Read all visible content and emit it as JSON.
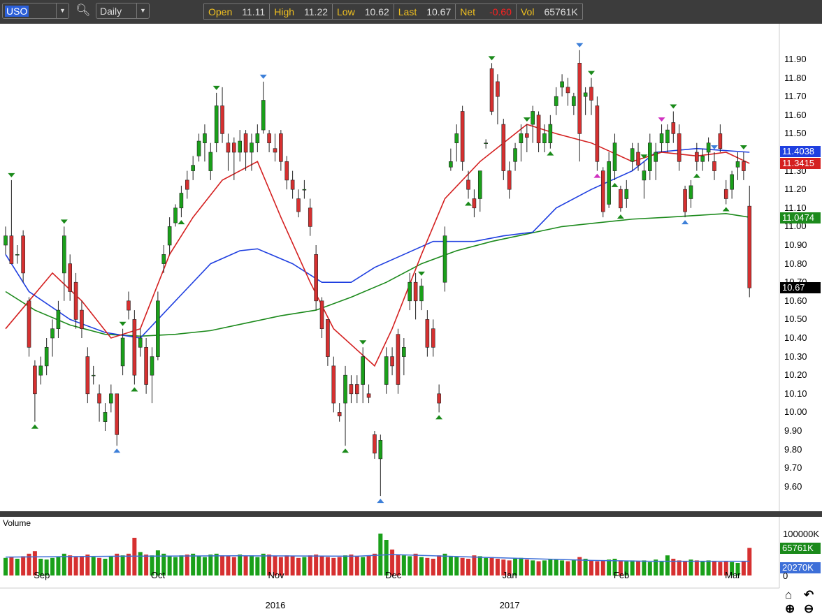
{
  "toolbar": {
    "symbol": "USO",
    "interval": "Daily",
    "open_label": "Open",
    "open": "11.11",
    "high_label": "High",
    "high": "11.22",
    "low_label": "Low",
    "low": "10.62",
    "last_label": "Last",
    "last": "10.67",
    "net_label": "Net",
    "net": "-0.60",
    "vol_label": "Vol",
    "vol": "65761K",
    "icons": {
      "search": "search-icon",
      "dropdown": "chevron-down-icon"
    }
  },
  "colors": {
    "up": "#1aa01a",
    "down": "#d63030",
    "ma_short": "#d42020",
    "ma_mid": "#1f3fe0",
    "ma_long": "#1c8a1c",
    "net": "#ff2020",
    "label": "#f0c020"
  },
  "price_tags": {
    "ma_mid": "11.4038",
    "ma_short": "11.3415",
    "ma_long": "11.0474",
    "last": "10.67"
  },
  "volume": {
    "title": "Volume",
    "max_label": "100000K",
    "last_label": "65761K",
    "avg_label": "20270K",
    "zero_label": "0"
  },
  "x_labels": {
    "months": [
      "Sep",
      "Oct",
      "Nov",
      "Dec",
      "Jan",
      "Feb",
      "Mar"
    ],
    "years": [
      "2016",
      "2017"
    ]
  },
  "nav_icons": [
    "home-icon",
    "undo-icon",
    "zoom-in-icon",
    "zoom-out-icon"
  ],
  "chart_data": {
    "type": "candlestick",
    "ylim": [
      9.52,
      12.08
    ],
    "y_ticks": [
      "11.90",
      "11.80",
      "11.70",
      "11.60",
      "11.50",
      "11.40",
      "11.30",
      "11.20",
      "11.10",
      "11.00",
      "10.90",
      "10.80",
      "10.70",
      "10.60",
      "10.50",
      "10.40",
      "10.30",
      "10.20",
      "10.10",
      "10.00",
      "9.90",
      "9.80",
      "9.70",
      "9.60"
    ],
    "month_start_index": [
      6,
      26,
      46,
      66,
      86,
      105,
      124
    ],
    "ohlc": [
      [
        10.9,
        11.0,
        10.85,
        10.95
      ],
      [
        10.95,
        11.25,
        10.8,
        10.8
      ],
      [
        10.85,
        10.9,
        10.8,
        10.85
      ],
      [
        10.95,
        10.98,
        10.7,
        10.75
      ],
      [
        10.6,
        10.62,
        10.3,
        10.35
      ],
      [
        10.25,
        10.28,
        9.95,
        10.1
      ],
      [
        10.2,
        10.3,
        10.15,
        10.25
      ],
      [
        10.25,
        10.4,
        10.2,
        10.35
      ],
      [
        10.4,
        10.5,
        10.3,
        10.45
      ],
      [
        10.45,
        10.6,
        10.4,
        10.55
      ],
      [
        10.75,
        11.0,
        10.6,
        10.95
      ],
      [
        10.8,
        10.85,
        10.6,
        10.65
      ],
      [
        10.7,
        10.75,
        10.45,
        10.5
      ],
      [
        10.55,
        10.6,
        10.4,
        10.45
      ],
      [
        10.3,
        10.35,
        10.05,
        10.1
      ],
      [
        10.2,
        10.25,
        10.15,
        10.2
      ],
      [
        10.1,
        10.15,
        9.95,
        10.05
      ],
      [
        9.95,
        10.05,
        9.9,
        10.0
      ],
      [
        10.05,
        10.15,
        10.0,
        10.1
      ],
      [
        10.1,
        10.1,
        9.82,
        9.88
      ],
      [
        10.25,
        10.45,
        10.2,
        10.4
      ],
      [
        10.6,
        10.65,
        10.5,
        10.55
      ],
      [
        10.5,
        10.55,
        10.15,
        10.2
      ],
      [
        10.35,
        10.45,
        10.3,
        10.4
      ],
      [
        10.35,
        10.4,
        10.1,
        10.15
      ],
      [
        10.2,
        10.35,
        10.05,
        10.3
      ],
      [
        10.3,
        10.65,
        10.28,
        10.6
      ],
      [
        10.8,
        10.9,
        10.75,
        10.85
      ],
      [
        10.9,
        11.05,
        10.85,
        11.0
      ],
      [
        11.02,
        11.12,
        11.0,
        11.1
      ],
      [
        11.1,
        11.22,
        11.05,
        11.18
      ],
      [
        11.25,
        11.3,
        11.15,
        11.2
      ],
      [
        11.3,
        11.38,
        11.25,
        11.33
      ],
      [
        11.38,
        11.5,
        11.35,
        11.46
      ],
      [
        11.45,
        11.55,
        11.35,
        11.5
      ],
      [
        11.3,
        11.45,
        11.25,
        11.4
      ],
      [
        11.45,
        11.72,
        11.4,
        11.65
      ],
      [
        11.65,
        11.75,
        11.45,
        11.5
      ],
      [
        11.45,
        11.5,
        11.3,
        11.4
      ],
      [
        11.45,
        11.48,
        11.25,
        11.4
      ],
      [
        11.4,
        11.52,
        11.35,
        11.46
      ],
      [
        11.5,
        11.52,
        11.3,
        11.4
      ],
      [
        11.4,
        11.5,
        11.3,
        11.45
      ],
      [
        11.45,
        11.55,
        11.4,
        11.5
      ],
      [
        11.52,
        11.78,
        11.5,
        11.68
      ],
      [
        11.5,
        11.52,
        11.4,
        11.45
      ],
      [
        11.42,
        11.5,
        11.35,
        11.4
      ],
      [
        11.5,
        11.52,
        11.3,
        11.35
      ],
      [
        11.35,
        11.38,
        11.2,
        11.25
      ],
      [
        11.25,
        11.3,
        11.15,
        11.2
      ],
      [
        11.15,
        11.2,
        11.05,
        11.08
      ],
      [
        11.2,
        11.25,
        11.15,
        11.2
      ],
      [
        11.1,
        11.15,
        10.95,
        11.0
      ],
      [
        10.85,
        10.9,
        10.55,
        10.6
      ],
      [
        10.6,
        10.62,
        10.4,
        10.45
      ],
      [
        10.5,
        10.5,
        10.25,
        10.3
      ],
      [
        10.25,
        10.3,
        10.0,
        10.05
      ],
      [
        10.0,
        10.05,
        9.95,
        9.98
      ],
      [
        10.05,
        10.25,
        9.82,
        10.2
      ],
      [
        10.15,
        10.2,
        10.05,
        10.1
      ],
      [
        10.15,
        10.2,
        10.05,
        10.1
      ],
      [
        10.15,
        10.35,
        10.05,
        10.3
      ],
      [
        10.1,
        10.15,
        10.05,
        10.08
      ],
      [
        9.88,
        9.9,
        9.75,
        9.78
      ],
      [
        9.75,
        9.88,
        9.55,
        9.85
      ],
      [
        10.15,
        10.35,
        10.1,
        10.3
      ],
      [
        10.3,
        10.35,
        10.2,
        10.25
      ],
      [
        10.42,
        10.45,
        10.1,
        10.15
      ],
      [
        10.3,
        10.4,
        10.2,
        10.35
      ],
      [
        10.6,
        10.75,
        10.55,
        10.7
      ],
      [
        10.7,
        10.75,
        10.5,
        10.6
      ],
      [
        10.6,
        10.72,
        10.55,
        10.68
      ],
      [
        10.5,
        10.55,
        10.3,
        10.35
      ],
      [
        10.45,
        10.5,
        10.3,
        10.35
      ],
      [
        10.1,
        10.15,
        10.0,
        10.05
      ],
      [
        10.7,
        11.0,
        10.65,
        10.95
      ],
      [
        11.32,
        11.42,
        11.3,
        11.35
      ],
      [
        11.45,
        11.55,
        11.35,
        11.5
      ],
      [
        11.62,
        11.65,
        11.3,
        11.35
      ],
      [
        11.25,
        11.3,
        11.15,
        11.2
      ],
      [
        11.15,
        11.2,
        11.05,
        11.1
      ],
      [
        11.15,
        11.3,
        11.08,
        11.3
      ],
      [
        11.45,
        11.47,
        11.42,
        11.45
      ],
      [
        11.85,
        11.88,
        11.6,
        11.62
      ],
      [
        11.78,
        11.82,
        11.55,
        11.7
      ],
      [
        11.55,
        11.58,
        11.25,
        11.3
      ],
      [
        11.3,
        11.35,
        11.15,
        11.2
      ],
      [
        11.35,
        11.45,
        11.3,
        11.42
      ],
      [
        11.45,
        11.55,
        11.35,
        11.5
      ],
      [
        11.5,
        11.55,
        11.4,
        11.48
      ],
      [
        11.55,
        11.65,
        11.45,
        11.62
      ],
      [
        11.6,
        11.62,
        11.4,
        11.45
      ],
      [
        11.45,
        11.55,
        11.4,
        11.5
      ],
      [
        11.45,
        11.6,
        11.42,
        11.55
      ],
      [
        11.65,
        11.75,
        11.6,
        11.7
      ],
      [
        11.75,
        11.82,
        11.7,
        11.78
      ],
      [
        11.75,
        11.8,
        11.65,
        11.72
      ],
      [
        11.65,
        11.72,
        11.6,
        11.7
      ],
      [
        11.88,
        11.95,
        11.35,
        11.5
      ],
      [
        11.7,
        11.75,
        11.6,
        11.72
      ],
      [
        11.75,
        11.8,
        11.6,
        11.68
      ],
      [
        11.65,
        11.7,
        11.3,
        11.35
      ],
      [
        11.3,
        11.32,
        11.05,
        11.08
      ],
      [
        11.12,
        11.4,
        11.1,
        11.35
      ],
      [
        11.3,
        11.5,
        11.25,
        11.45
      ],
      [
        11.2,
        11.22,
        11.08,
        11.1
      ],
      [
        11.15,
        11.25,
        11.1,
        11.2
      ],
      [
        11.35,
        11.45,
        11.3,
        11.42
      ],
      [
        11.4,
        11.45,
        11.3,
        11.33
      ],
      [
        11.25,
        11.35,
        11.15,
        11.3
      ],
      [
        11.3,
        11.5,
        11.25,
        11.45
      ],
      [
        11.35,
        11.45,
        11.25,
        11.4
      ],
      [
        11.45,
        11.55,
        11.4,
        11.5
      ],
      [
        11.45,
        11.55,
        11.4,
        11.52
      ],
      [
        11.56,
        11.62,
        11.45,
        11.5
      ],
      [
        11.5,
        11.55,
        11.3,
        11.35
      ],
      [
        11.2,
        11.22,
        11.05,
        11.08
      ],
      [
        11.15,
        11.25,
        11.1,
        11.22
      ],
      [
        11.4,
        11.45,
        11.3,
        11.35
      ],
      [
        11.35,
        11.42,
        11.3,
        11.38
      ],
      [
        11.4,
        11.48,
        11.35,
        11.45
      ],
      [
        11.35,
        11.4,
        11.25,
        11.3
      ],
      [
        11.5,
        11.55,
        11.4,
        11.42
      ],
      [
        11.2,
        11.25,
        11.12,
        11.15
      ],
      [
        11.2,
        11.3,
        11.15,
        11.28
      ],
      [
        11.32,
        11.4,
        11.25,
        11.35
      ],
      [
        11.35,
        11.4,
        11.25,
        11.3
      ],
      [
        11.11,
        11.22,
        10.62,
        10.67
      ]
    ],
    "volume_k": [
      42000,
      44000,
      40000,
      46000,
      52000,
      58000,
      40000,
      38000,
      42000,
      45000,
      52000,
      48000,
      44000,
      46000,
      50000,
      44000,
      42000,
      40000,
      45000,
      52000,
      48000,
      52000,
      90000,
      56000,
      50000,
      48000,
      60000,
      52000,
      46000,
      44000,
      48000,
      50000,
      52000,
      46000,
      44000,
      50000,
      52000,
      48000,
      46000,
      44000,
      50000,
      46000,
      48000,
      44000,
      52000,
      50000,
      46000,
      44000,
      48000,
      46000,
      42000,
      44000,
      48000,
      50000,
      46000,
      44000,
      42000,
      44000,
      48000,
      50000,
      46000,
      44000,
      48000,
      52000,
      100000,
      85000,
      62000,
      50000,
      48000,
      46000,
      52000,
      44000,
      42000,
      40000,
      48000,
      52000,
      46000,
      44000,
      42000,
      40000,
      48000,
      46000,
      42000,
      44000,
      40000,
      38000,
      36000,
      40000,
      42000,
      38000,
      36000,
      34000,
      36000,
      40000,
      38000,
      36000,
      34000,
      38000,
      44000,
      40000,
      36000,
      34000,
      36000,
      38000,
      40000,
      36000,
      34000,
      36000,
      34000,
      36000,
      32000,
      38000,
      34000,
      48000,
      40000,
      36000,
      34000,
      38000,
      36000,
      34000,
      36000,
      34000,
      32000,
      34000,
      32000,
      30000,
      34000,
      65761
    ],
    "volume_avg_k": 20270,
    "ma_short": [
      [
        0,
        10.45
      ],
      [
        4,
        10.6
      ],
      [
        8,
        10.75
      ],
      [
        13,
        10.6
      ],
      [
        18,
        10.4
      ],
      [
        23,
        10.45
      ],
      [
        28,
        10.85
      ],
      [
        32,
        11.05
      ],
      [
        37,
        11.25
      ],
      [
        43,
        11.35
      ],
      [
        47,
        11.05
      ],
      [
        52,
        10.7
      ],
      [
        56,
        10.45
      ],
      [
        63,
        10.25
      ],
      [
        66,
        10.45
      ],
      [
        71,
        10.85
      ],
      [
        75,
        11.15
      ],
      [
        81,
        11.35
      ],
      [
        85,
        11.45
      ],
      [
        89,
        11.55
      ],
      [
        94,
        11.5
      ],
      [
        100,
        11.45
      ],
      [
        107,
        11.35
      ],
      [
        112,
        11.4
      ],
      [
        118,
        11.38
      ],
      [
        123,
        11.4
      ],
      [
        127,
        11.34
      ]
    ],
    "ma_mid": [
      [
        0,
        10.85
      ],
      [
        4,
        10.65
      ],
      [
        11,
        10.5
      ],
      [
        17,
        10.43
      ],
      [
        23,
        10.4
      ],
      [
        29,
        10.6
      ],
      [
        35,
        10.8
      ],
      [
        40,
        10.87
      ],
      [
        43,
        10.88
      ],
      [
        49,
        10.8
      ],
      [
        54,
        10.7
      ],
      [
        59,
        10.7
      ],
      [
        63,
        10.78
      ],
      [
        68,
        10.85
      ],
      [
        73,
        10.92
      ],
      [
        80,
        10.92
      ],
      [
        85,
        10.95
      ],
      [
        90,
        10.97
      ],
      [
        94,
        11.1
      ],
      [
        100,
        11.2
      ],
      [
        107,
        11.3
      ],
      [
        111,
        11.4
      ],
      [
        118,
        11.42
      ],
      [
        127,
        11.4
      ]
    ],
    "ma_long": [
      [
        0,
        10.65
      ],
      [
        5,
        10.55
      ],
      [
        11,
        10.47
      ],
      [
        17,
        10.42
      ],
      [
        23,
        10.41
      ],
      [
        29,
        10.42
      ],
      [
        35,
        10.44
      ],
      [
        41,
        10.48
      ],
      [
        47,
        10.52
      ],
      [
        53,
        10.55
      ],
      [
        59,
        10.62
      ],
      [
        65,
        10.7
      ],
      [
        71,
        10.8
      ],
      [
        77,
        10.87
      ],
      [
        83,
        10.92
      ],
      [
        89,
        10.96
      ],
      [
        95,
        11.0
      ],
      [
        101,
        11.02
      ],
      [
        107,
        11.04
      ],
      [
        113,
        11.05
      ],
      [
        118,
        11.06
      ],
      [
        123,
        11.07
      ],
      [
        127,
        11.05
      ]
    ],
    "markers": [
      {
        "i": 1,
        "type": "high",
        "color": "green"
      },
      {
        "i": 5,
        "type": "low",
        "color": "green"
      },
      {
        "i": 10,
        "type": "high",
        "color": "green"
      },
      {
        "i": 19,
        "type": "low",
        "color": "blue"
      },
      {
        "i": 22,
        "type": "low",
        "color": "green"
      },
      {
        "i": 30,
        "type": "low",
        "color": "green"
      },
      {
        "i": 36,
        "type": "high",
        "color": "green"
      },
      {
        "i": 44,
        "type": "high",
        "color": "blue"
      },
      {
        "i": 20,
        "type": "high",
        "color": "green"
      },
      {
        "i": 58,
        "type": "low",
        "color": "green"
      },
      {
        "i": 64,
        "type": "low",
        "color": "blue"
      },
      {
        "i": 61,
        "type": "high",
        "color": "green"
      },
      {
        "i": 71,
        "type": "high",
        "color": "green"
      },
      {
        "i": 74,
        "type": "low",
        "color": "green"
      },
      {
        "i": 79,
        "type": "low",
        "color": "green"
      },
      {
        "i": 83,
        "type": "high",
        "color": "green"
      },
      {
        "i": 89,
        "type": "high",
        "color": "green"
      },
      {
        "i": 98,
        "type": "high",
        "color": "blue"
      },
      {
        "i": 101,
        "type": "low",
        "color": "magenta"
      },
      {
        "i": 104,
        "type": "low",
        "color": "green"
      },
      {
        "i": 100,
        "type": "high",
        "color": "green"
      },
      {
        "i": 93,
        "type": "low",
        "color": "green"
      },
      {
        "i": 109,
        "type": "high",
        "color": "green"
      },
      {
        "i": 105,
        "type": "low",
        "color": "green"
      },
      {
        "i": 112,
        "type": "high",
        "color": "magenta"
      },
      {
        "i": 116,
        "type": "low",
        "color": "blue"
      },
      {
        "i": 114,
        "type": "high",
        "color": "green"
      },
      {
        "i": 118,
        "type": "low",
        "color": "green"
      },
      {
        "i": 121,
        "type": "high",
        "color": "blue"
      },
      {
        "i": 123,
        "type": "low",
        "color": "green"
      },
      {
        "i": 126,
        "type": "high",
        "color": "green"
      }
    ]
  }
}
